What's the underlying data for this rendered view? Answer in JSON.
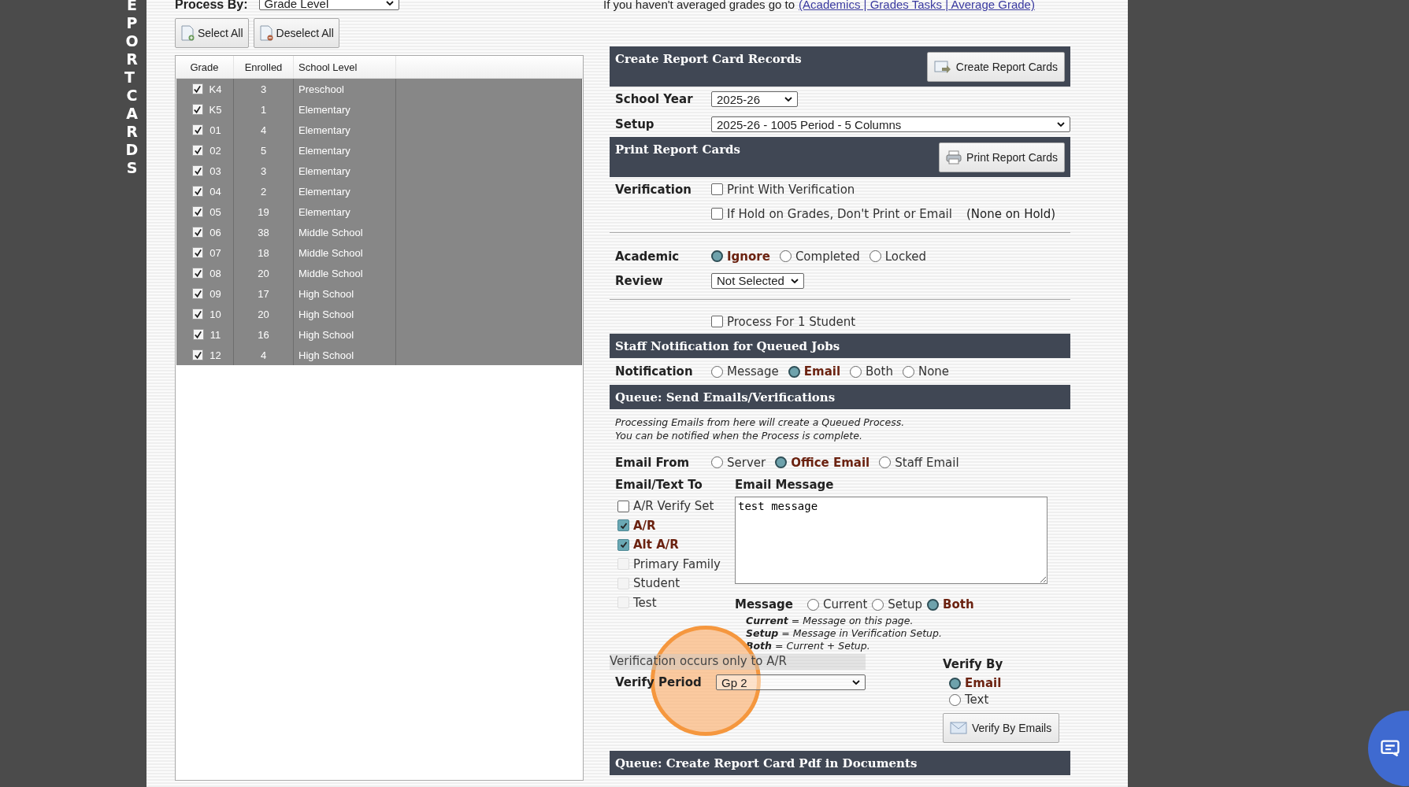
{
  "side_title": "EPORT CARDS",
  "process_by": {
    "label": "Process By:",
    "value": "Grade Level"
  },
  "buttons": [
    {
      "label": "Select All",
      "kind": "add"
    },
    {
      "label": "Deselect All",
      "kind": "remove"
    }
  ],
  "grade_table": {
    "columns": [
      "Grade",
      "Enrolled",
      "School Level"
    ],
    "rows": [
      {
        "grade": "K4",
        "checked": true,
        "enrolled": "3",
        "level": "Preschool"
      },
      {
        "grade": "K5",
        "checked": true,
        "enrolled": "1",
        "level": "Elementary"
      },
      {
        "grade": "01",
        "checked": true,
        "enrolled": "4",
        "level": "Elementary"
      },
      {
        "grade": "02",
        "checked": true,
        "enrolled": "5",
        "level": "Elementary"
      },
      {
        "grade": "03",
        "checked": true,
        "enrolled": "3",
        "level": "Elementary"
      },
      {
        "grade": "04",
        "checked": true,
        "enrolled": "2",
        "level": "Elementary"
      },
      {
        "grade": "05",
        "checked": true,
        "enrolled": "19",
        "level": "Elementary"
      },
      {
        "grade": "06",
        "checked": true,
        "enrolled": "38",
        "level": "Middle School"
      },
      {
        "grade": "07",
        "checked": true,
        "enrolled": "18",
        "level": "Middle School"
      },
      {
        "grade": "08",
        "checked": true,
        "enrolled": "20",
        "level": "Middle School"
      },
      {
        "grade": "09",
        "checked": true,
        "enrolled": "17",
        "level": "High School"
      },
      {
        "grade": "10",
        "checked": true,
        "enrolled": "20",
        "level": "High School"
      },
      {
        "grade": "11",
        "checked": true,
        "enrolled": "16",
        "level": "High School"
      },
      {
        "grade": "12",
        "checked": true,
        "enrolled": "4",
        "level": "High School"
      }
    ]
  },
  "notice": {
    "text": "If you haven't averaged grades go to",
    "link": "(Academics | Grades Tasks | Average Grade)"
  },
  "create_section": {
    "title": "Create Report Card Records",
    "button": "Create Report Cards"
  },
  "school_year": {
    "label": "School Year",
    "value": "2025-26"
  },
  "setup": {
    "label": "Setup",
    "value": "2025-26 - 1005 Period - 5 Columns"
  },
  "print_section": {
    "title": "Print Report Cards",
    "button": "Print Report Cards"
  },
  "verification": {
    "label": "Verification",
    "options": [
      {
        "label": "Print With Verification",
        "checked": false
      },
      {
        "label": "If Hold on Grades, Don't Print or Email",
        "checked": false
      }
    ],
    "hold_note": "(None on Hold)"
  },
  "academic": {
    "label": "Academic",
    "options": [
      {
        "label": "Ignore",
        "selected": true
      },
      {
        "label": "Completed",
        "selected": false
      },
      {
        "label": "Locked",
        "selected": false
      }
    ]
  },
  "review": {
    "label": "Review",
    "value": "Not Selected"
  },
  "one_student": {
    "label": "Process For 1 Student",
    "checked": false
  },
  "staff_section": {
    "title": "Staff Notification for Queued Jobs"
  },
  "notification": {
    "label": "Notification",
    "options": [
      {
        "label": "Message",
        "selected": false
      },
      {
        "label": "Email",
        "selected": true
      },
      {
        "label": "Both",
        "selected": false
      },
      {
        "label": "None",
        "selected": false
      }
    ]
  },
  "queue_email_section": {
    "title": "Queue: Send Emails/Verifications",
    "note": [
      "Processing Emails from here will create a Queued Process.",
      "You can be notified when the Process is complete."
    ]
  },
  "email_from": {
    "label": "Email From",
    "options": [
      {
        "label": "Server",
        "selected": false
      },
      {
        "label": "Office Email",
        "selected": true
      },
      {
        "label": "Staff Email",
        "selected": false
      }
    ]
  },
  "email_to": {
    "label": "Email/Text To",
    "options": [
      {
        "label": "A/R Verify Set",
        "checked": false,
        "disabled": false
      },
      {
        "label": "A/R",
        "checked": true,
        "disabled": false
      },
      {
        "label": "Alt A/R",
        "checked": true,
        "disabled": false
      },
      {
        "label": "Primary Family",
        "checked": false,
        "disabled": true
      },
      {
        "label": "Student",
        "checked": false,
        "disabled": true
      },
      {
        "label": "Test",
        "checked": false,
        "disabled": true
      }
    ]
  },
  "email_message": {
    "label": "Email Message",
    "value": "test message"
  },
  "message": {
    "label": "Message",
    "options": [
      {
        "label": "Current",
        "selected": false
      },
      {
        "label": "Setup",
        "selected": false
      },
      {
        "label": "Both",
        "selected": true
      }
    ],
    "legend": [
      "**Current** = Message on this page.",
      "**Setup** = Message in Verification Setup.",
      "**Both** = Current + Setup."
    ]
  },
  "verification_note": "Verification occurs only to A/R",
  "verify_period": {
    "label": "Verify Period",
    "value": "Gp 2"
  },
  "verify_by": {
    "label": "Verify By",
    "options": [
      {
        "label": "Email",
        "selected": true
      },
      {
        "label": "Text",
        "selected": false
      }
    ],
    "button": "Verify By Emails"
  },
  "pdf_section": {
    "title": "Queue: Create Report Card Pdf in Documents"
  }
}
